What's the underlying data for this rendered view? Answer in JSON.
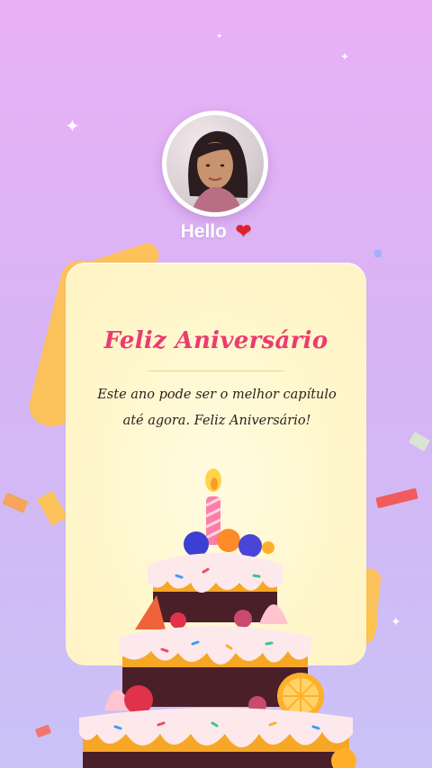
{
  "header": {
    "greeting": "Hello",
    "heart_icon": "❤"
  },
  "card": {
    "title": "Feliz Aniversário",
    "message": "Este ano pode ser o melhor capítulo até agora. Feliz Aniversário!"
  },
  "colors": {
    "background_top": "#e9b1f6",
    "background_bottom": "#c9c2f7",
    "card": "#fff7cc",
    "title": "#ec3b6e",
    "heart": "#e0202a"
  },
  "icons": [
    "sparkle-icon",
    "heart-icon",
    "cake-illustration",
    "candle-icon",
    "confetti-icon",
    "ribbon-icon"
  ]
}
